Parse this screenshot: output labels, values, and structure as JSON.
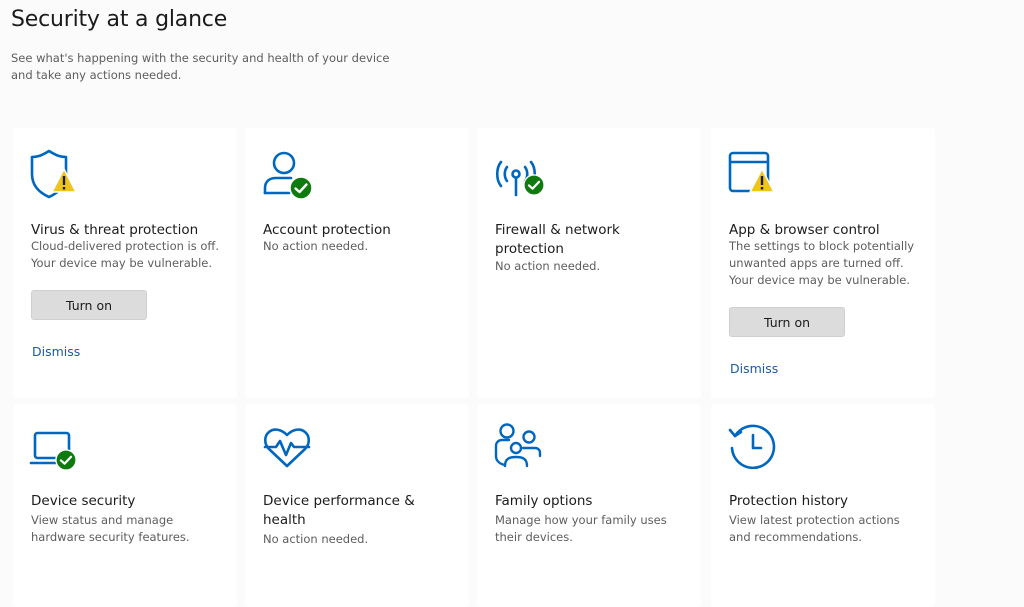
{
  "header": {
    "title": "Security at a glance",
    "subtitle_line1": "See what's happening with the security and health of your device",
    "subtitle_line2": "and take any actions needed."
  },
  "colors": {
    "accent": "#0067c0",
    "ok_badge": "#0f7b0f",
    "warn_badge": "#f0c419",
    "link": "#1a5aa6"
  },
  "tiles": [
    {
      "title_line1": "Virus & threat protection",
      "title_line2": "",
      "desc_line1": "Cloud-delivered protection is off.",
      "desc_line2": "Your device may be vulnerable.",
      "desc_line3": "",
      "button": "Turn on",
      "link": "Dismiss",
      "icon": "shield-icon",
      "status": "warning"
    },
    {
      "title_line1": "Account protection",
      "title_line2": "",
      "desc_line1": "No action needed.",
      "desc_line2": "",
      "desc_line3": "",
      "icon": "person-icon",
      "status": "ok"
    },
    {
      "title_line1": "Firewall & network",
      "title_line2": "protection",
      "desc_line1": "No action needed.",
      "desc_line2": "",
      "desc_line3": "",
      "icon": "antenna-icon",
      "status": "ok"
    },
    {
      "title_line1": "App & browser control",
      "title_line2": "",
      "desc_line1": "The settings to block potentially",
      "desc_line2": "unwanted apps are turned off.",
      "desc_line3": "Your device may be vulnerable.",
      "button": "Turn on",
      "link": "Dismiss",
      "icon": "browser-window-icon",
      "status": "warning"
    },
    {
      "title_line1": "Device security",
      "title_line2": "",
      "desc_line1": "View status and manage",
      "desc_line2": "hardware security features.",
      "desc_line3": "",
      "icon": "laptop-icon",
      "status": "ok"
    },
    {
      "title_line1": "Device performance &",
      "title_line2": "health",
      "desc_line1": "No action needed.",
      "desc_line2": "",
      "desc_line3": "",
      "icon": "heart-pulse-icon",
      "status": "none"
    },
    {
      "title_line1": "Family options",
      "title_line2": "",
      "desc_line1": "Manage how your family uses",
      "desc_line2": "their devices.",
      "desc_line3": "",
      "icon": "family-icon",
      "status": "none"
    },
    {
      "title_line1": "Protection history",
      "title_line2": "",
      "desc_line1": "View latest protection actions",
      "desc_line2": "and recommendations.",
      "desc_line3": "",
      "icon": "history-clock-icon",
      "status": "none"
    }
  ]
}
